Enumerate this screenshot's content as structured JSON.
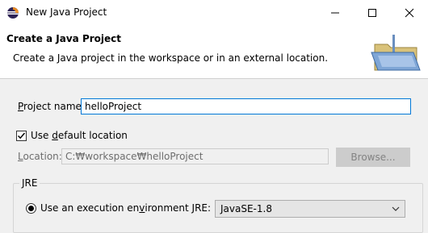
{
  "window": {
    "title": "New Java Project"
  },
  "header": {
    "title": "Create a Java Project",
    "description": "Create a Java project in the workspace or in an external location."
  },
  "project_name": {
    "label_prefix": "P",
    "label_rest": "roject name:",
    "value": "helloProject"
  },
  "use_default_location": {
    "label_prefix": "Use ",
    "label_mnemonic": "d",
    "label_rest": "efault location",
    "checked": true
  },
  "location": {
    "label_mnemonic": "L",
    "label_rest": "ocation:",
    "value": "C:₩workspace₩helloProject",
    "browse_label": "Browse..."
  },
  "jre": {
    "group_label": "JRE",
    "option_label_prefix": "Use an execution en",
    "option_label_mnemonic": "v",
    "option_label_rest": "ironment JRE:",
    "selected_environment": "JavaSE-1.8"
  },
  "colors": {
    "focus_border": "#0078d7",
    "window_bg": "#f0f0f0",
    "header_bg": "#ffffff"
  }
}
